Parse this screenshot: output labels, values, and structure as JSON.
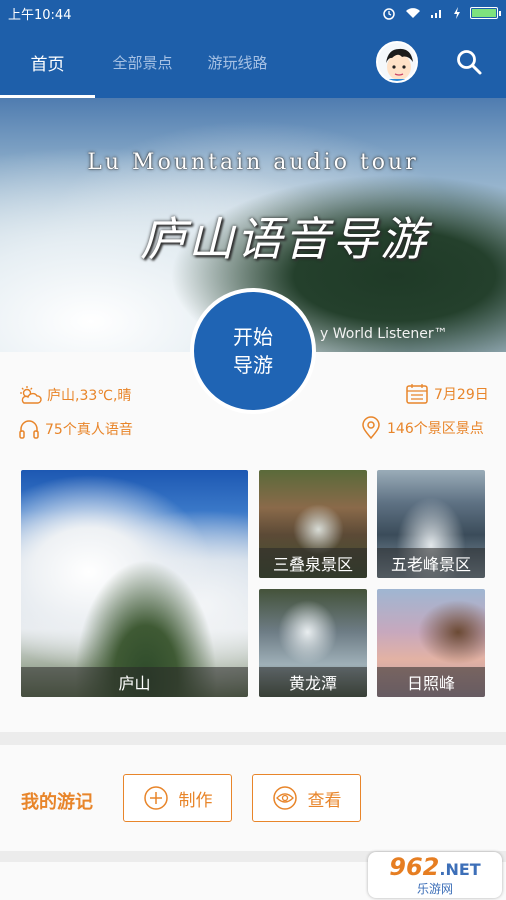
{
  "statusbar": {
    "time": "上午10:44"
  },
  "nav": {
    "tabs": [
      {
        "label": "首页",
        "active": true
      },
      {
        "label": "全部景点",
        "active": false
      },
      {
        "label": "游玩线路",
        "active": false
      }
    ]
  },
  "banner": {
    "title_en": "Lu Mountain audio tour",
    "title_cn": "庐山语音导游",
    "slogan": "y World Listener™"
  },
  "start_button": {
    "line1": "开始",
    "line2": "导游"
  },
  "info": {
    "weather": "庐山,33℃,晴",
    "date": "7月29日",
    "voices": "75个真人语音",
    "spots": "146个景区景点"
  },
  "tiles": [
    {
      "label": "庐山"
    },
    {
      "label": "三叠泉景区"
    },
    {
      "label": "五老峰景区"
    },
    {
      "label": "黄龙潭"
    },
    {
      "label": "日照峰"
    }
  ],
  "journal": {
    "label": "我的游记",
    "make_label": "制作",
    "view_label": "查看"
  },
  "watermark": {
    "num": "962",
    "net": ".NET",
    "sub": "乐游网"
  },
  "colors": {
    "primary": "#1e5faa",
    "accent": "#e8852a"
  }
}
